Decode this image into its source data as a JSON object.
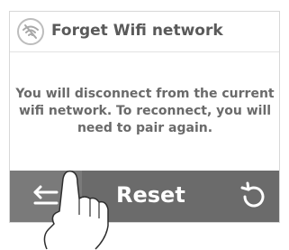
{
  "dialog": {
    "title": "Forget Wifi network",
    "message": "You will disconnect from the current wifi network. To reconnect, you will need to pair again."
  },
  "footer": {
    "reset_label": "Reset"
  },
  "icons": {
    "header": "wifi-off-icon",
    "back": "back-arrow-icon",
    "reset": "reset-icon",
    "pointer": "hand-pointer-icon"
  },
  "colors": {
    "footer_bg": "#6b6b6b",
    "back_bg": "#7a7a7a",
    "title_text": "#5a5a5a",
    "message_text": "#6a6a6a"
  }
}
